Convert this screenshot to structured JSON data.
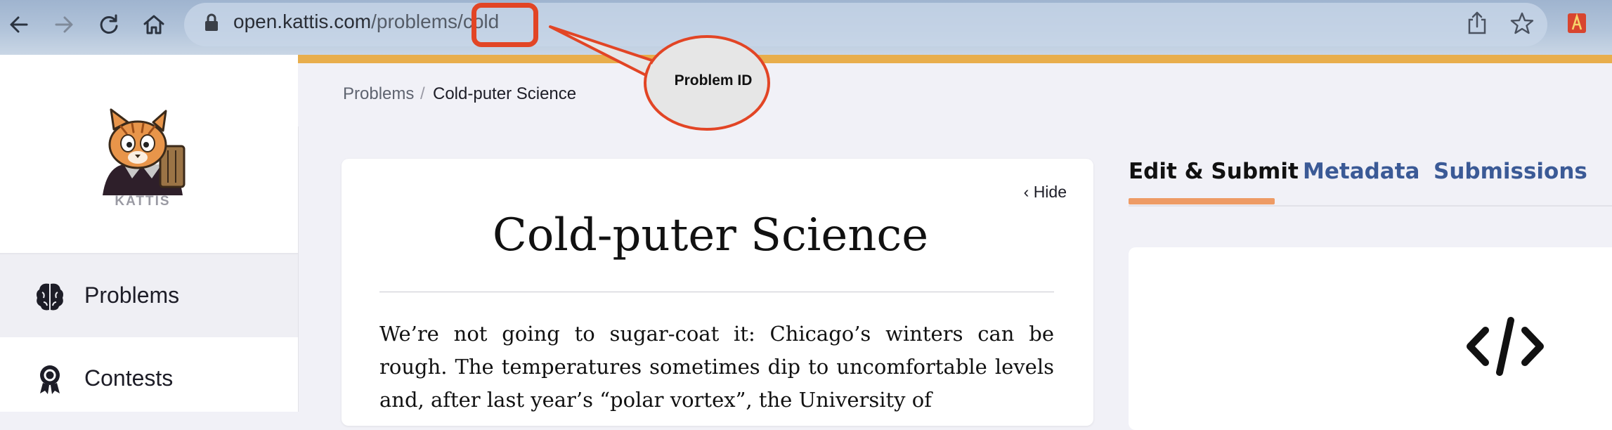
{
  "browser": {
    "url_host": "open.kattis.com",
    "url_path": "/problems/cold",
    "icons": [
      "back-icon",
      "forward-icon",
      "reload-icon",
      "home-icon",
      "lock-icon",
      "share-icon",
      "star-icon",
      "extension-icon"
    ]
  },
  "annotation": {
    "label": "Problem ID",
    "color": "#e24525"
  },
  "sidebar": {
    "brand": "KATTIS",
    "items": [
      {
        "label": "Problems",
        "icon": "brain-icon",
        "active": true
      },
      {
        "label": "Contests",
        "icon": "award-ribbon-icon",
        "active": false
      }
    ]
  },
  "breadcrumb": {
    "root": "Problems",
    "separator": "/",
    "current": "Cold-puter Science"
  },
  "problem": {
    "hide_label": "Hide",
    "title": "Cold-puter Science",
    "body": "We’re not going to sugar-coat it: Chicago’s winters can be rough. The temperatures sometimes dip to uncomfortable levels and, after last year’s “polar vortex”, the University of"
  },
  "tabs": [
    {
      "label": "Edit & Submit",
      "active": true
    },
    {
      "label": "Metadata",
      "active": false
    },
    {
      "label": "Submissions",
      "active": false
    }
  ],
  "colors": {
    "accent_orange": "#e8ae4c",
    "tab_active_underline": "#ee9b65",
    "tab_link": "#3b5a96"
  }
}
